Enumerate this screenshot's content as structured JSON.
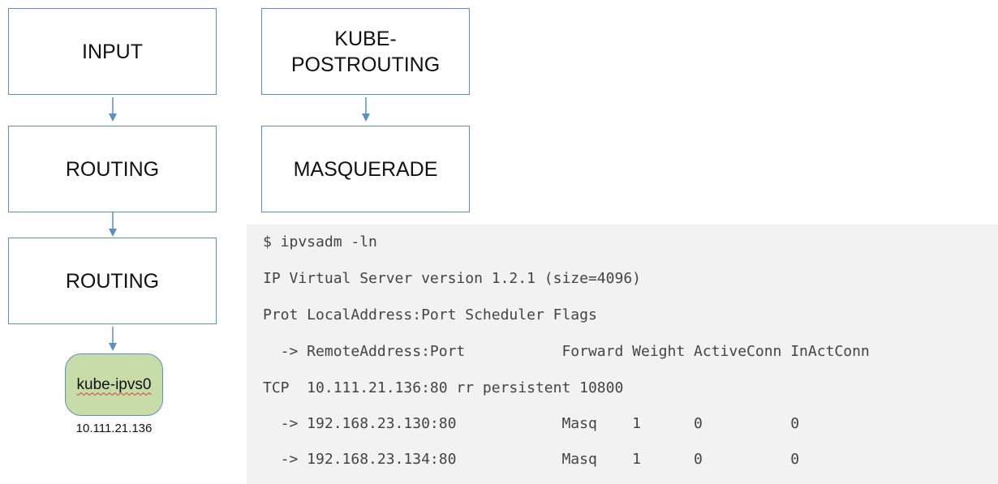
{
  "flow_left": {
    "input": "INPUT",
    "routing_1": "ROUTING",
    "routing_2": "ROUTING"
  },
  "flow_right": {
    "kube_postrouting_line1": "KUBE-",
    "kube_postrouting_line2": "POSTROUTING",
    "masquerade": "MASQUERADE"
  },
  "interface": {
    "name": "kube-ipvs0",
    "ip": "10.111.21.136"
  },
  "terminal": {
    "lines": [
      "$ ipvsadm -ln",
      "IP Virtual Server version 1.2.1 (size=4096)",
      "Prot LocalAddress:Port Scheduler Flags",
      "  -> RemoteAddress:Port           Forward Weight ActiveConn InActConn",
      "TCP  10.111.21.136:80 rr persistent 10800",
      "  -> 192.168.23.130:80            Masq    1      0          0",
      "  -> 192.168.23.134:80            Masq    1      0          0"
    ]
  },
  "colors": {
    "box_border": "#5b8fc7",
    "interface_fill": "#c8dca8",
    "terminal_bg": "#f2f2f2",
    "terminal_text": "#444444"
  }
}
